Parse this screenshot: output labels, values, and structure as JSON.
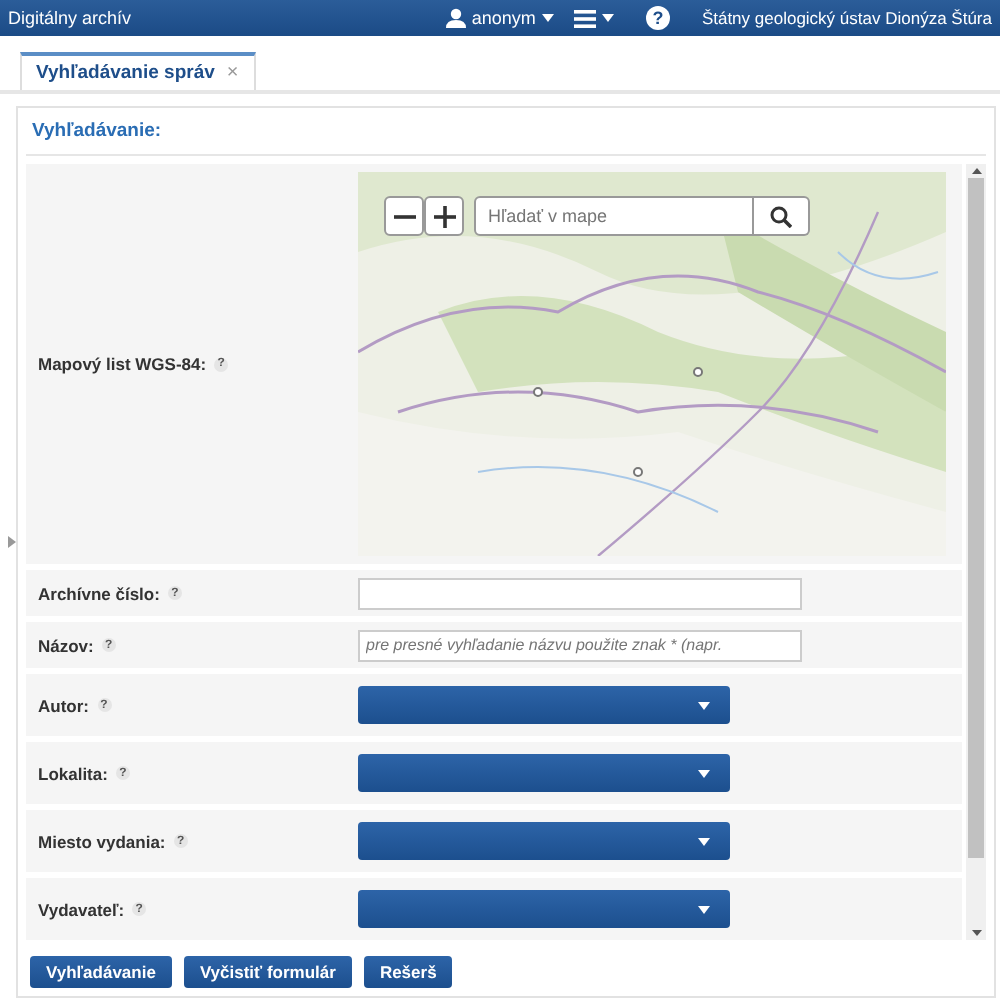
{
  "header": {
    "title": "Digitálny archív",
    "user": "anonym",
    "help": "?",
    "organization": "Štátny geologický ústav Dionýza Štúra"
  },
  "tabs": [
    {
      "label": "Vyhľadávanie správ",
      "selected": true,
      "close": "×"
    }
  ],
  "section_title": "Vyhľadávanie:",
  "map_search": {
    "placeholder": "Hľadať v mape"
  },
  "fields": [
    {
      "kind": "map",
      "label": "Mapový list WGS-84:",
      "help": "?"
    },
    {
      "kind": "text",
      "label": "Archívne číslo:",
      "help": "?"
    },
    {
      "kind": "text",
      "label": "Názov:",
      "help": "?",
      "placeholder": "pre presné vyhľadanie názvu použite znak * (napr."
    },
    {
      "kind": "select",
      "label": "Autor:",
      "help": "?"
    },
    {
      "kind": "select",
      "label": "Lokalita:",
      "help": "?"
    },
    {
      "kind": "select",
      "label": "Miesto vydania:",
      "help": "?"
    },
    {
      "kind": "select",
      "label": "Vydavateľ:",
      "help": "?"
    }
  ],
  "buttons": [
    "Vyhľadávanie",
    "Vyčistiť formulár",
    "Rešerš"
  ]
}
